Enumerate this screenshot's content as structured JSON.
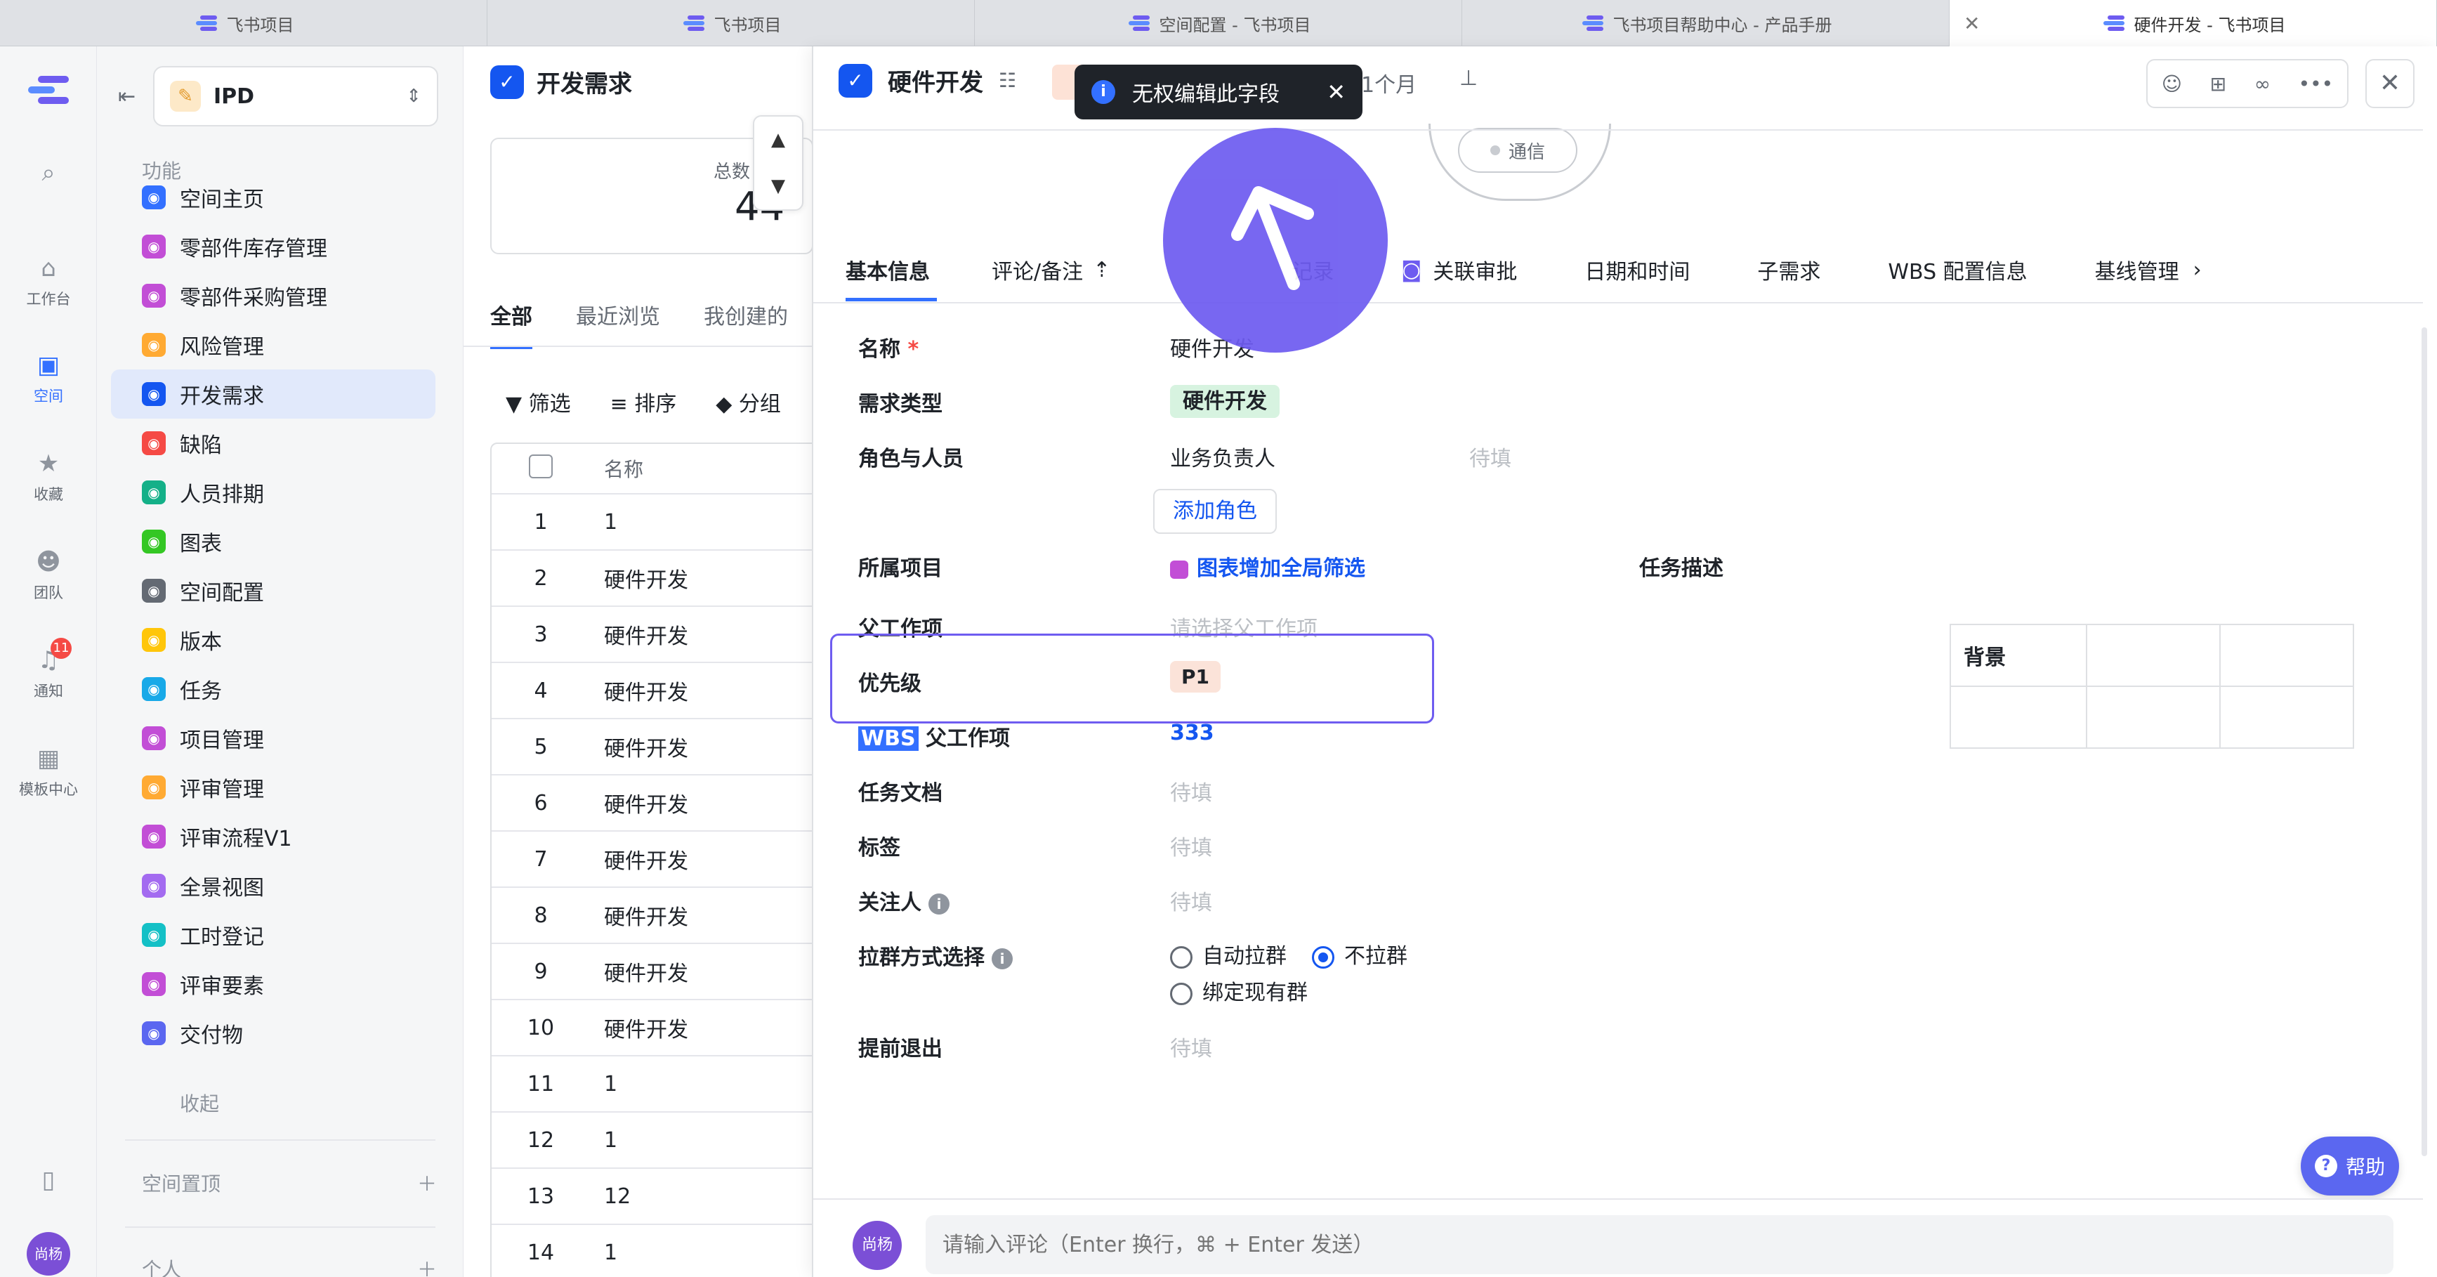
{
  "browser_tabs": [
    {
      "title": "飞书项目",
      "active": false
    },
    {
      "title": "飞书项目",
      "active": false
    },
    {
      "title": "空间配置 - 飞书项目",
      "active": false
    },
    {
      "title": "飞书项目帮助中心 - 产品手册",
      "active": false
    },
    {
      "title": "硬件开发 - 飞书项目",
      "active": true
    }
  ],
  "rail": {
    "items": [
      {
        "label": "工作台",
        "icon": "home-icon"
      },
      {
        "label": "空间",
        "icon": "space-icon",
        "active": true
      },
      {
        "label": "收藏",
        "icon": "star-icon"
      },
      {
        "label": "团队",
        "icon": "team-icon"
      },
      {
        "label": "通知",
        "icon": "bell-icon",
        "badge": "11"
      },
      {
        "label": "模板中心",
        "icon": "template-icon"
      }
    ],
    "avatar": "尚杨"
  },
  "sidebar": {
    "space_name": "IPD",
    "section_label": "功能",
    "items": [
      {
        "label": "空间主页",
        "color": "#3370ff"
      },
      {
        "label": "零部件库存管理",
        "color": "#c24ed6"
      },
      {
        "label": "零部件采购管理",
        "color": "#c24ed6"
      },
      {
        "label": "风险管理",
        "color": "#ffaa33"
      },
      {
        "label": "开发需求",
        "color": "#1456f0",
        "active": true
      },
      {
        "label": "缺陷",
        "color": "#f54a45"
      },
      {
        "label": "人员排期",
        "color": "#14b088"
      },
      {
        "label": "图表",
        "color": "#34c724"
      },
      {
        "label": "空间配置",
        "color": "#646a73"
      },
      {
        "label": "版本",
        "color": "#ffc60a"
      },
      {
        "label": "任务",
        "color": "#18a9e8"
      },
      {
        "label": "项目管理",
        "color": "#c24ed6"
      },
      {
        "label": "评审管理",
        "color": "#ffaa33"
      },
      {
        "label": "评审流程V1",
        "color": "#c24ed6"
      },
      {
        "label": "全景视图",
        "color": "#a36bf0"
      },
      {
        "label": "工时登记",
        "color": "#14c0c6"
      },
      {
        "label": "评审要素",
        "color": "#c24ed6"
      },
      {
        "label": "交付物",
        "color": "#5b67f0"
      }
    ],
    "collapse_label": "收起",
    "group_pinned": "空间置顶",
    "group_personal": "个人"
  },
  "list_panel": {
    "title": "开发需求",
    "count_label": "总数",
    "count_value": "44",
    "tabs": [
      "全部",
      "最近浏览",
      "我创建的"
    ],
    "toolbar": {
      "filter": "筛选",
      "sort": "排序",
      "group": "分组"
    },
    "table": {
      "header": "名称",
      "rows": [
        {
          "no": "1",
          "name": "1"
        },
        {
          "no": "2",
          "name": "硬件开发"
        },
        {
          "no": "3",
          "name": "硬件开发"
        },
        {
          "no": "4",
          "name": "硬件开发"
        },
        {
          "no": "5",
          "name": "硬件开发"
        },
        {
          "no": "6",
          "name": "硬件开发"
        },
        {
          "no": "7",
          "name": "硬件开发"
        },
        {
          "no": "8",
          "name": "硬件开发"
        },
        {
          "no": "9",
          "name": "硬件开发"
        },
        {
          "no": "10",
          "name": "硬件开发"
        },
        {
          "no": "11",
          "name": "1"
        },
        {
          "no": "12",
          "name": "1"
        },
        {
          "no": "13",
          "name": "12"
        },
        {
          "no": "14",
          "name": "1"
        }
      ]
    }
  },
  "detail": {
    "title": "硬件开发",
    "tag_letter": "P",
    "duration": "1个月",
    "node_label": "通信",
    "toast": "无权编辑此字段",
    "tabs": [
      "基本信息",
      "评论/备注",
      "记录",
      "关联审批",
      "日期和时间",
      "子需求",
      "WBS 配置信息",
      "基线管理"
    ],
    "fields": {
      "name_label": "名称",
      "name_required": "*",
      "name_value": "硬件开发",
      "type_label": "需求类型",
      "type_value": "硬件开发",
      "roles_label": "角色与人员",
      "roles_role": "业务负责人",
      "roles_value": "待填",
      "add_role": "添加角色",
      "project_label": "所属项目",
      "project_value": "图表增加全局筛选",
      "parent_label": "父工作项",
      "parent_placeholder": "请选择父工作项",
      "priority_label": "优先级",
      "priority_value": "P1",
      "wbs_label_hl": "WBS",
      "wbs_label_rest": " 父工作项",
      "wbs_value": "333",
      "doc_label": "任务文档",
      "doc_value": "待填",
      "tag_label": "标签",
      "tag_value": "待填",
      "watcher_label": "关注人",
      "watcher_value": "待填",
      "group_label": "拉群方式选择",
      "group_opt1": "自动拉群",
      "group_opt2": "不拉群",
      "group_opt3": "绑定现有群",
      "exit_label": "提前退出",
      "exit_value": "待填"
    },
    "task_desc_label": "任务描述",
    "bg_table_header": "背景",
    "help": "帮助",
    "comment_avatar": "尚杨",
    "comment_placeholder": "请输入评论（Enter 换行，⌘ + Enter 发送）"
  }
}
